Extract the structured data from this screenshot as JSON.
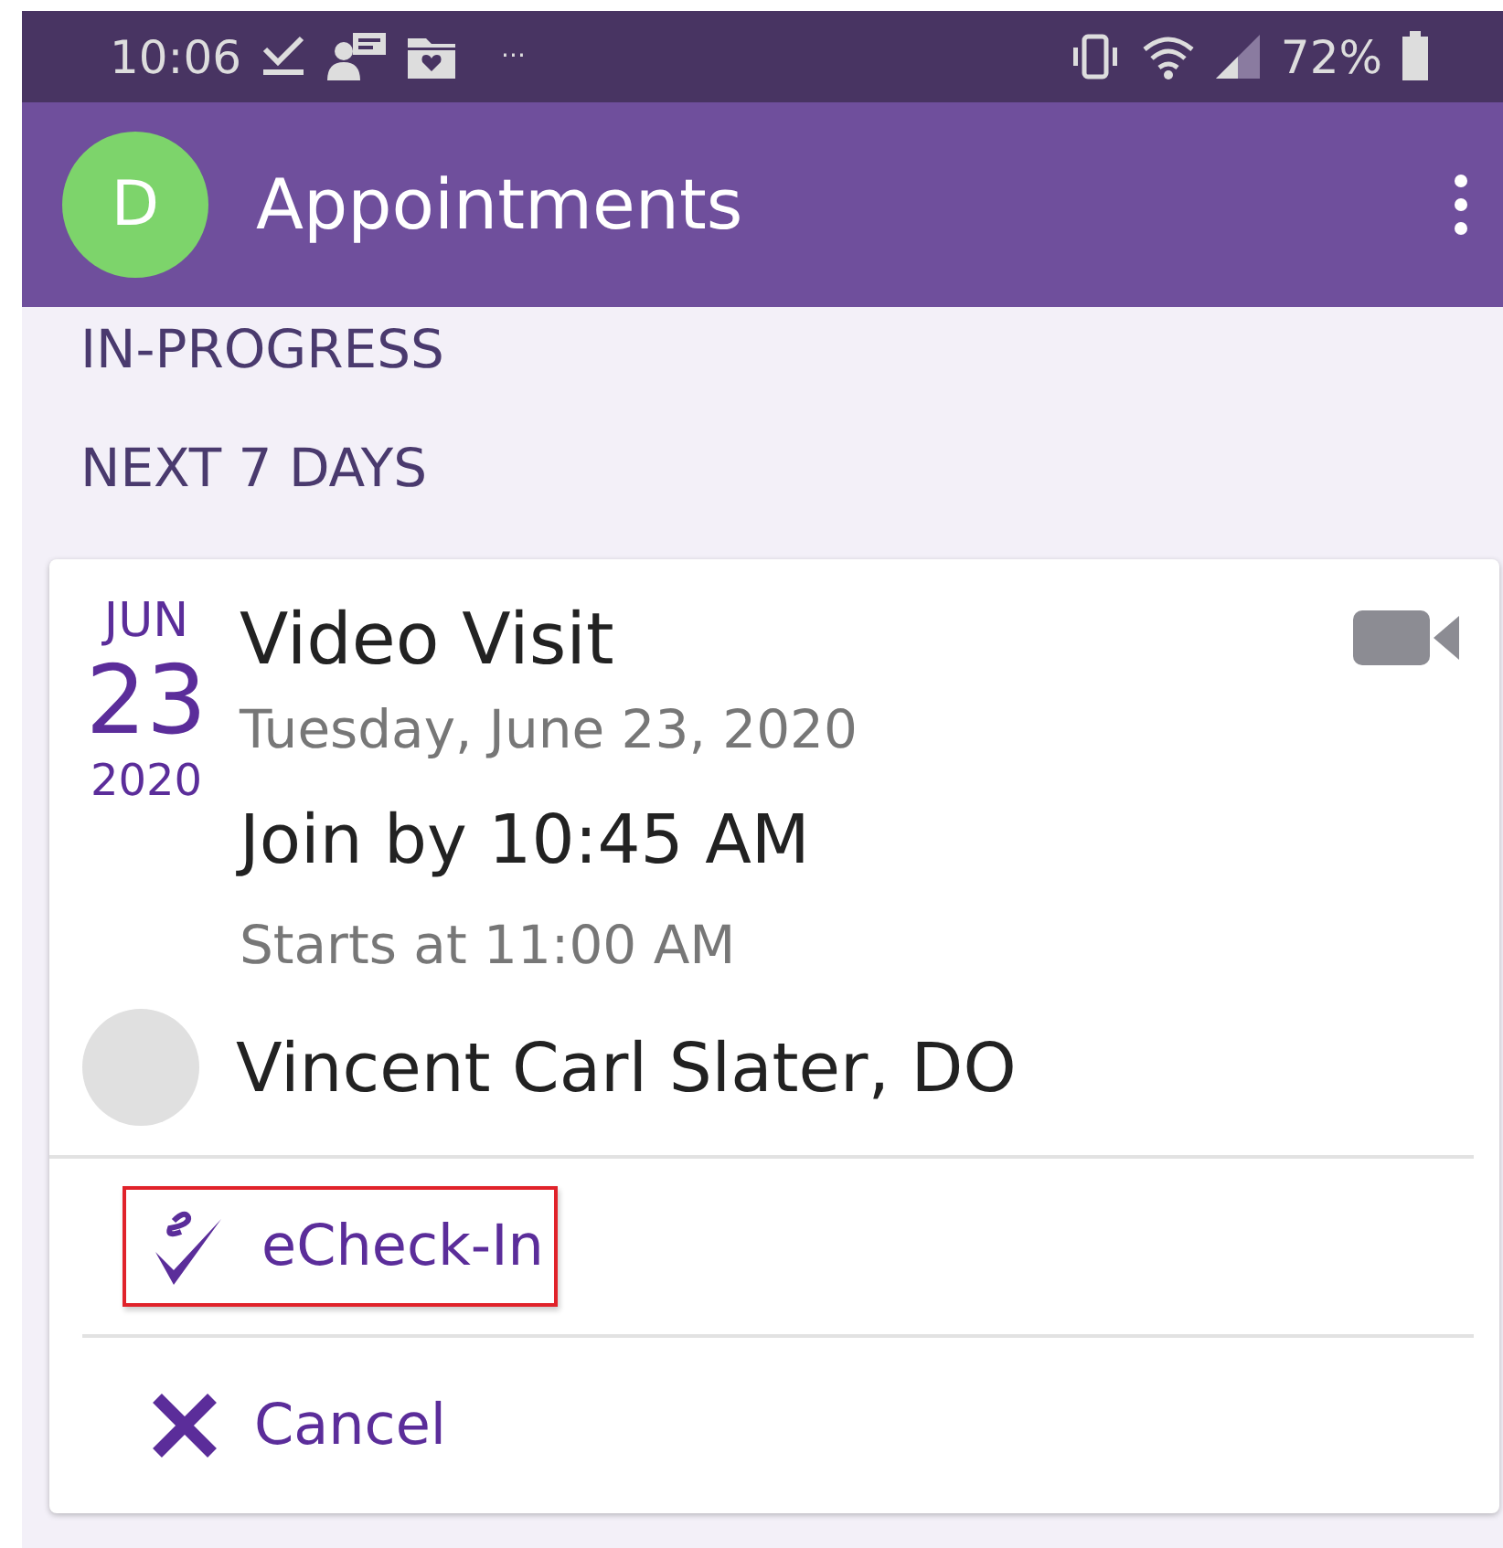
{
  "status_bar": {
    "time": "10:06",
    "overflow": "···",
    "battery": "72%"
  },
  "app_bar": {
    "avatar_letter": "D",
    "title": "Appointments"
  },
  "sections": [
    {
      "label": "IN-PROGRESS"
    },
    {
      "label": "NEXT 7 DAYS"
    }
  ],
  "appointment": {
    "month": "JUN",
    "day": "23",
    "year": "2020",
    "title": "Video Visit",
    "date": "Tuesday, June 23, 2020",
    "join": "Join by 10:45 AM",
    "starts": "Starts at 11:00 AM",
    "provider": "Vincent Carl Slater, DO",
    "actions": [
      {
        "kind": "echeckin",
        "label": "eCheck-In",
        "highlighted": true
      },
      {
        "kind": "cancel",
        "label": "Cancel",
        "highlighted": false
      }
    ]
  }
}
